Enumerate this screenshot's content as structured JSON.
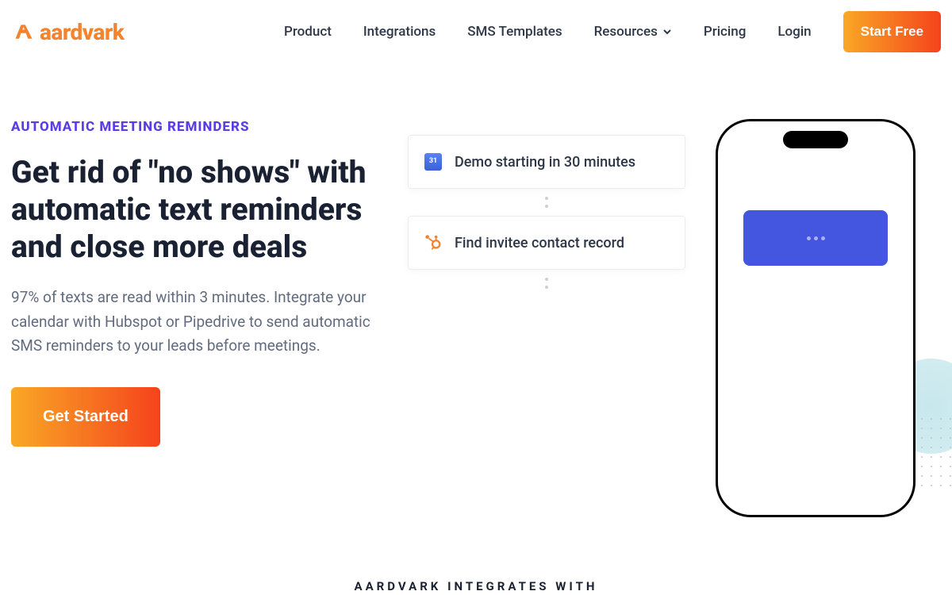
{
  "brand": {
    "name": "aardvark"
  },
  "nav": {
    "product": "Product",
    "integrations": "Integrations",
    "sms_templates": "SMS Templates",
    "resources": "Resources",
    "pricing": "Pricing",
    "login": "Login",
    "start_free": "Start Free"
  },
  "hero": {
    "eyebrow": "AUTOMATIC MEETING REMINDERS",
    "headline": "Get rid of \"no shows\" with automatic text reminders and close more deals",
    "body": "97% of texts are read within 3 minutes. Integrate your calendar with Hubspot or Pipedrive to send automatic SMS reminders to your leads before meetings.",
    "cta": "Get Started"
  },
  "workflow": {
    "step1": "Demo starting in 30 minutes",
    "step2": "Find invitee contact record"
  },
  "footer": {
    "integrates_with": "AARDVARK INTEGRATES WITH"
  }
}
